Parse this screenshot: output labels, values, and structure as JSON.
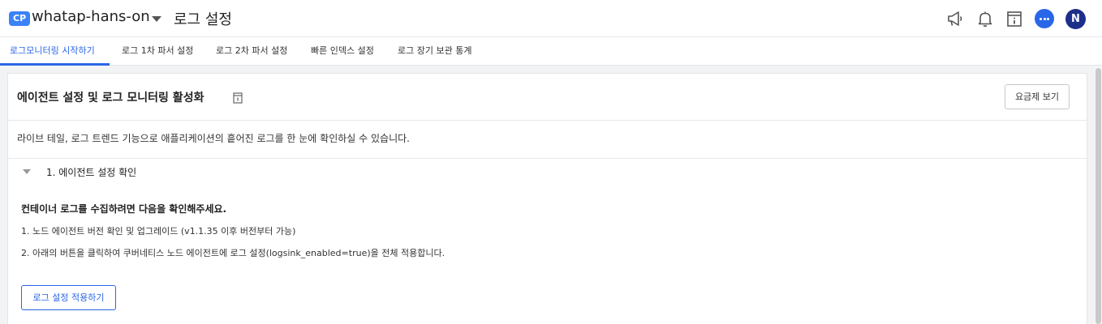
{
  "header": {
    "badge": "CP",
    "project_name": "whatap-hans-on",
    "page_title": "로그 설정",
    "avatar_initial": "N",
    "accent_color": "#2a66e8"
  },
  "tabs": [
    {
      "label": "로그모니터링 시작하기",
      "active": true
    },
    {
      "label": "로그 1차 파서 설정",
      "active": false
    },
    {
      "label": "로그 2차 파서 설정",
      "active": false
    },
    {
      "label": "빠른 인덱스 설정",
      "active": false
    },
    {
      "label": "로그 장기 보관 통계",
      "active": false
    }
  ],
  "card": {
    "title": "에이전트 설정 및 로그 모니터링 활성화",
    "pricing_button": "요금제 보기",
    "description": "라이브 테일, 로그 트렌드 기능으로 애플리케이션의 흩어진 로그를 한 눈에 확인하실 수 있습니다.",
    "section": {
      "title": "1. 에이전트 설정 확인",
      "heading": "컨테이너 로그를 수집하려면 다음을 확인해주세요.",
      "line1": "1. 노드 에이전트 버전 확인 및 업그레이드 (v1.1.35 이후 버전부터 가능)",
      "line2": "2. 아래의 버튼을 클릭하여 쿠버네티스 노드 에이전트에 로그 설정(logsink_enabled=true)을 전체 적용합니다.",
      "apply_button": "로그 설정 적용하기"
    }
  }
}
